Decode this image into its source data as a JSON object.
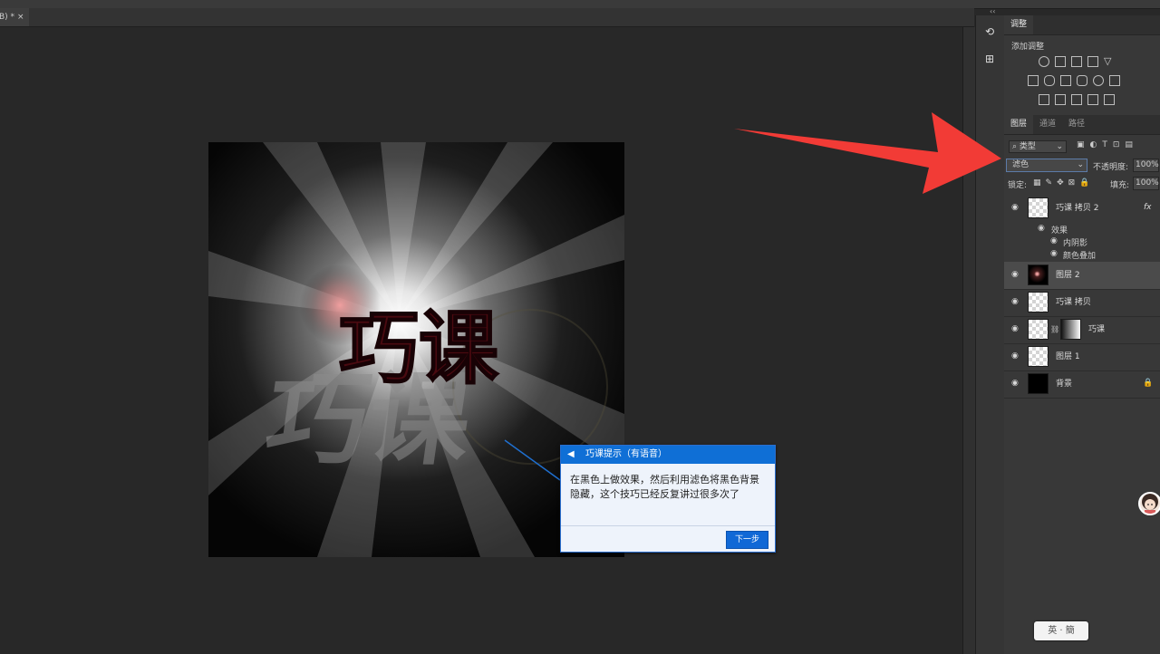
{
  "document": {
    "tab_title": "B) *",
    "close_glyph": "×"
  },
  "canvas": {
    "main_text": "巧课",
    "shadow_text": "巧课"
  },
  "tip": {
    "title": "巧课提示（有语音）",
    "speaker_icon": "speaker-icon",
    "message": "在黑色上做效果，然后利用滤色将黑色背景隐藏，这个技巧已经反复讲过很多次了",
    "next_button": "下一步",
    "accent_color": "#0f6fd6"
  },
  "toolstrip": {
    "collapse_glyph": "‹‹",
    "icons": [
      "history-icon",
      "properties-icon"
    ]
  },
  "adjustments": {
    "tab": "调整",
    "add_label": "添加调整"
  },
  "layers_panel": {
    "tabs": [
      "图层",
      "通道",
      "路径"
    ],
    "filter_kind": "类型",
    "blend_mode": "滤色",
    "opacity_label": "不透明度:",
    "opacity_value": "100%",
    "lock_label": "锁定:",
    "fill_label": "填充:",
    "fill_value": "100%",
    "layers": [
      {
        "name": "巧课 拷贝 2",
        "fx": "fx",
        "thumb": "transparent",
        "selected": false
      },
      {
        "name": "图层 2",
        "thumb": "glow",
        "selected": true
      },
      {
        "name": "巧课 拷贝",
        "thumb": "transparent",
        "selected": false
      },
      {
        "name": "巧课",
        "thumb": "transparent-mask",
        "selected": false
      },
      {
        "name": "图层 1",
        "thumb": "transparent",
        "selected": false
      },
      {
        "name": "背景",
        "thumb": "black",
        "locked": true,
        "selected": false
      }
    ],
    "effects_label": "效果",
    "effects": [
      "内阴影",
      "颜色叠加"
    ]
  },
  "ime": {
    "label": "英 · 簡"
  },
  "annotation_arrow_color": "#f23b36"
}
